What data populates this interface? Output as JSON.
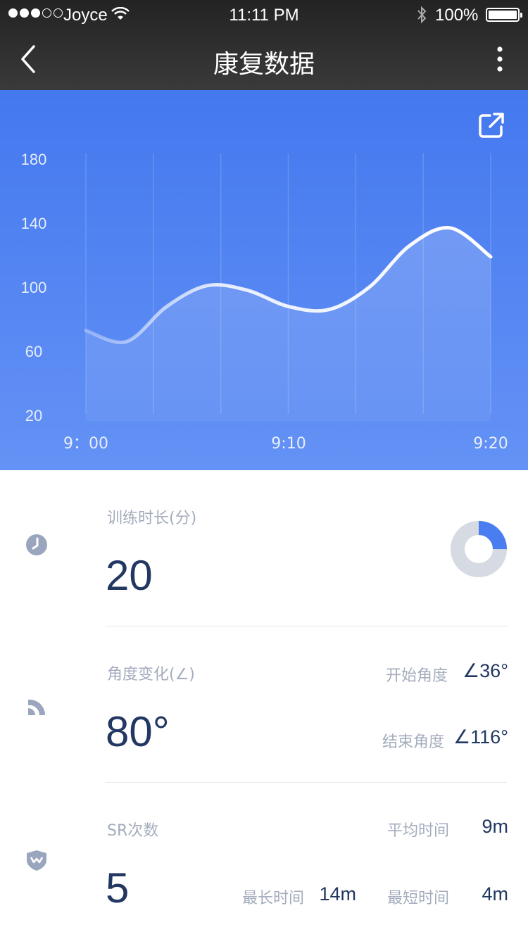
{
  "status_bar": {
    "carrier": "Joyce",
    "time": "11:11 PM",
    "battery": "100%"
  },
  "nav": {
    "title": "康复数据"
  },
  "chart_data": {
    "type": "line",
    "y_ticks": [
      "180",
      "140",
      "100",
      "60",
      "20"
    ],
    "x_ticks": [
      "9：00",
      "9:10",
      "9:20"
    ],
    "ylim": [
      20,
      180
    ],
    "series": [
      {
        "points": [
          [
            0,
            73
          ],
          [
            1,
            66
          ],
          [
            2,
            88
          ],
          [
            3,
            101
          ],
          [
            4,
            98
          ],
          [
            5,
            88
          ],
          [
            6,
            86
          ],
          [
            7,
            100
          ],
          [
            8,
            126
          ],
          [
            9,
            137
          ],
          [
            10,
            119
          ]
        ]
      }
    ],
    "grid": "vertical",
    "colors": {
      "line": "#ffffff",
      "background": "#4a7ef0"
    }
  },
  "training": {
    "label": "训练时长(分)",
    "value": "20",
    "ring_fraction": 0.25
  },
  "angle": {
    "label": "角度变化(∠)",
    "value": "80°",
    "start_label": "开始角度",
    "start_value": "∠36°",
    "end_label": "结束角度",
    "end_value": "∠116°"
  },
  "sr": {
    "label": "SR次数",
    "value": "5",
    "avg_label": "平均时间",
    "avg_value": "9m",
    "max_label": "最长时间",
    "max_value": "14m",
    "min_label": "最短时间",
    "min_value": "4m"
  },
  "colors": {
    "accent": "#4a7ef0",
    "text_dark": "#223761",
    "text_muted": "#a4acbd",
    "icon": "#9aa6bd",
    "ring_bg": "#d5dae3"
  }
}
